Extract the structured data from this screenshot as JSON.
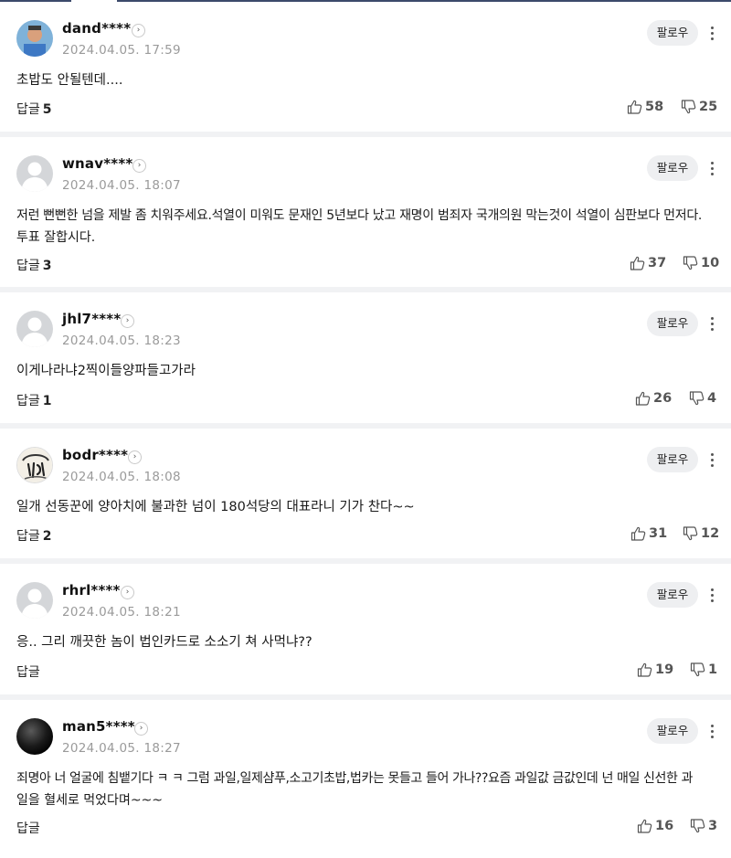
{
  "follow_label": "팔로우",
  "reply_label": "답글",
  "comments": [
    {
      "username": "dand****",
      "timestamp": "2024.04.05. 17:59",
      "text": "초밥도 안될텐데....",
      "replies": "5",
      "likes": "58",
      "dislikes": "25",
      "avatar": "photo"
    },
    {
      "username": "wnav****",
      "timestamp": "2024.04.05. 18:07",
      "text": "저런 뻔뻔한 넘을 제발 좀 치워주세요.석열이 미워도 문재인 5년보다 났고 재명이 범죄자 국개의원 막는것이 석열이 심판보다 먼저다.",
      "text2": "투표 잘합시다.",
      "replies": "3",
      "likes": "37",
      "dislikes": "10",
      "avatar": "default"
    },
    {
      "username": "jhl7****",
      "timestamp": "2024.04.05. 18:23",
      "text": "이게나라냐2찍이들양파들고가라",
      "replies": "1",
      "likes": "26",
      "dislikes": "4",
      "avatar": "default"
    },
    {
      "username": "bodr****",
      "timestamp": "2024.04.05. 18:08",
      "text": "일개 선동꾼에 양아치에 불과한 넘이 180석당의 대표라니 기가 찬다~~",
      "replies": "2",
      "likes": "31",
      "dislikes": "12",
      "avatar": "calligraphy"
    },
    {
      "username": "rhrl****",
      "timestamp": "2024.04.05. 18:21",
      "text": "응.. 그리 깨끗한 놈이 법인카드로 소소기 쳐 사먹냐??",
      "replies": "",
      "likes": "19",
      "dislikes": "1",
      "avatar": "default"
    },
    {
      "username": "man5****",
      "timestamp": "2024.04.05. 18:27",
      "text": "죄명아 너 얼굴에 침뱉기다 ㅋ ㅋ 그럼 과일,일제샴푸,소고기초밥,법카는 못들고 들어 가나??요즘 과일값 금값인데 넌 매일 신선한 과",
      "text2": "일을 혈세로 먹었다며~~~",
      "replies": "",
      "likes": "16",
      "dislikes": "3",
      "avatar": "dark"
    }
  ],
  "colors": {
    "accent_line": "#3b4a6b",
    "separator": "#f1f2f4",
    "follow_bg": "#eeeff1"
  },
  "icons": [
    "chevron-right-icon",
    "more-vertical-icon",
    "thumbs-up-icon",
    "thumbs-down-icon"
  ]
}
